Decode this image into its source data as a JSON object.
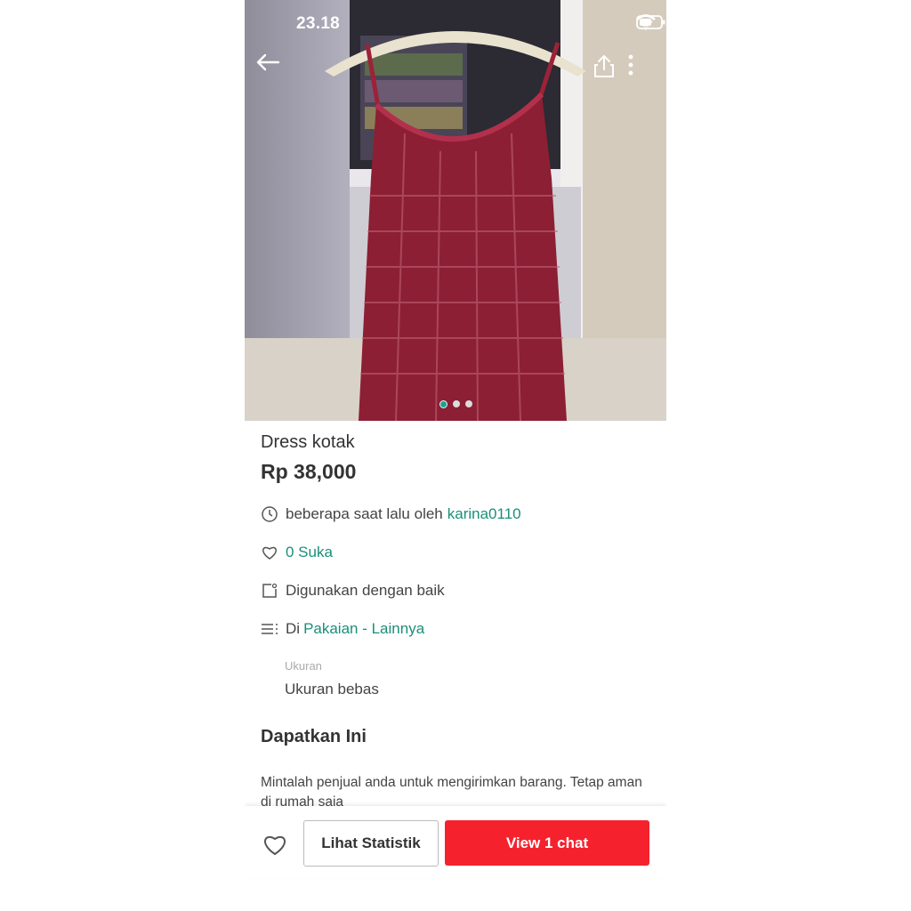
{
  "status_bar": {
    "time": "23.18"
  },
  "product": {
    "title": "Dress kotak",
    "price": "Rp 38,000",
    "image_count": 3,
    "active_image": 1
  },
  "details": {
    "posted_text": "beberapa saat lalu oleh",
    "seller": "karina0110",
    "likes": "0 Suka",
    "condition": "Digunakan dengan baik",
    "category_prefix": "Di",
    "category": "Pakaian - Lainnya",
    "size_label": "Ukuran",
    "size_value": "Ukuran bebas"
  },
  "section": {
    "title": "Dapatkan Ini",
    "description": "Mintalah penjual anda untuk mengirimkan barang. Tetap aman di rumah saja"
  },
  "actions": {
    "stats_label": "Lihat Statistik",
    "chat_label": "View 1 chat"
  },
  "colors": {
    "accent": "#1a8f7a",
    "primary_button": "#f5222d",
    "dress": "#8c1f33"
  },
  "icons": [
    "back-arrow-icon",
    "share-icon",
    "more-vert-icon",
    "clock-icon",
    "heart-icon",
    "condition-icon",
    "list-icon",
    "wifi-icon",
    "battery-icon"
  ]
}
